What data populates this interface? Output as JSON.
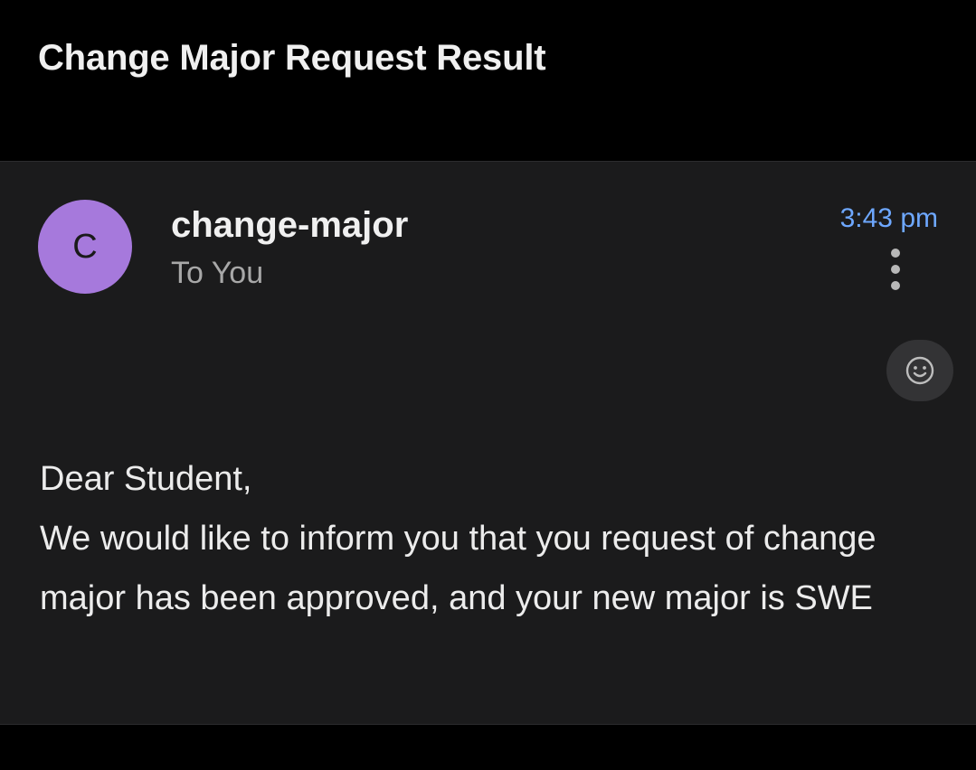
{
  "email": {
    "subject": "Change Major Request Result",
    "sender": {
      "name": "change-major",
      "avatar_initial": "C",
      "avatar_color": "#a679dc"
    },
    "recipient_label": "To You",
    "time": "3:43 pm",
    "time_color": "#6ea8ff",
    "more_icon": "more-vertical-icon",
    "react_icon": "smiley-icon",
    "body": {
      "greeting": "Dear Student,",
      "text": "We would like to inform you that you request of change major has been approved, and your new major is SWE"
    }
  }
}
